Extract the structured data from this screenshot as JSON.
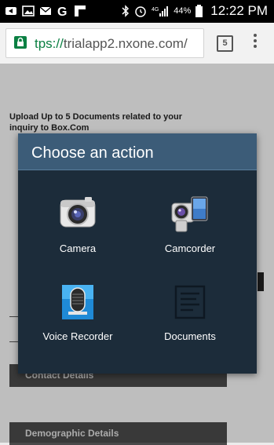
{
  "status_bar": {
    "battery": "44%",
    "time": "12:22 PM",
    "icons": [
      "back-arrow-icon",
      "image-icon",
      "mail-icon",
      "g-icon",
      "flipboard-icon",
      "bluetooth-icon",
      "alarm-icon",
      "4g-icon",
      "signal-icon",
      "battery-icon"
    ]
  },
  "browser": {
    "url_scheme": "tps://",
    "url_host": "trialapp2.nxone.com/",
    "url_tail": "/",
    "tab_count": "5"
  },
  "page": {
    "upload_text": "Upload Up to 5  Documents related to your inquiry to Box.Com",
    "section_contact": "Contact Details",
    "section_demographic": "Demographic Details"
  },
  "dialog": {
    "title": "Choose an action",
    "options": [
      {
        "label": "Camera",
        "icon": "camera-icon"
      },
      {
        "label": "Camcorder",
        "icon": "camcorder-icon"
      },
      {
        "label": "Voice Recorder",
        "icon": "voice-recorder-icon"
      },
      {
        "label": "Documents",
        "icon": "documents-icon"
      }
    ]
  },
  "colors": {
    "dialog_bg": "#1c2c3a",
    "dialog_header": "#3c5c78",
    "secure_green": "#0b8043"
  }
}
